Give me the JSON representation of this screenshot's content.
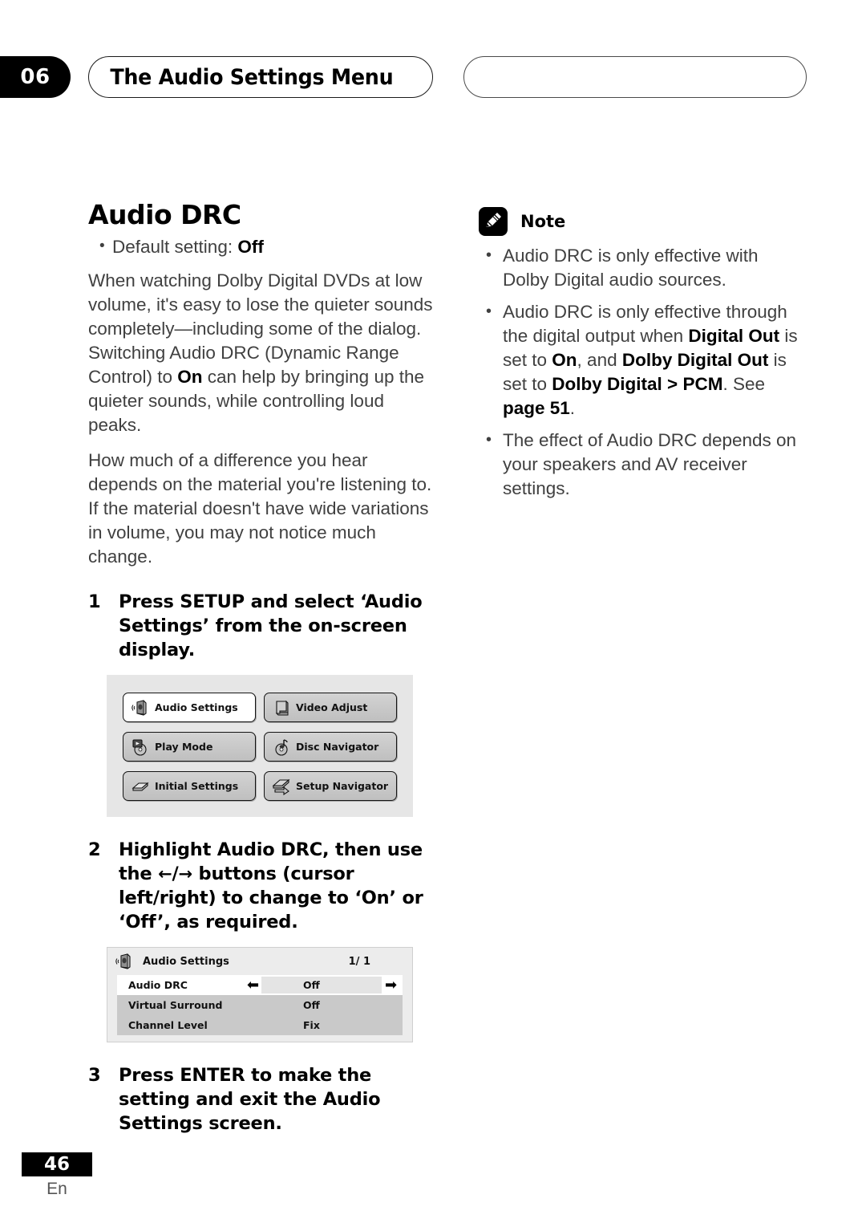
{
  "header": {
    "chapter_number": "06",
    "chapter_title": "The Audio Settings Menu"
  },
  "left_column": {
    "section_title": "Audio DRC",
    "default_setting_prefix": "Default setting: ",
    "default_setting_value": "Off",
    "paragraph_1_a": "When watching Dolby Digital DVDs at low volume, it's easy to lose the quieter sounds completely—including some of the dialog. Switching Audio DRC (Dynamic Range Control) to ",
    "paragraph_1_b": "On",
    "paragraph_1_c": " can help by bringing up the quieter sounds, while controlling loud peaks.",
    "paragraph_2": "How much of a difference you hear depends on the material you're listening to. If the material doesn't have wide variations in volume, you may not notice much change.",
    "steps": [
      {
        "num": "1",
        "text": "Press SETUP and select ‘Audio Settings’ from the on-screen display."
      },
      {
        "num": "2",
        "text_before_arrows": "Highlight Audio DRC, then use the ",
        "arrow_left": "←",
        "arrow_sep": "/",
        "arrow_right": "→",
        "text_after_arrows": " buttons (cursor left/right) to change to ‘On’ or ‘Off’, as required."
      },
      {
        "num": "3",
        "text": "Press ENTER to make the setting and exit the Audio Settings screen."
      }
    ]
  },
  "osd_menu": {
    "items": [
      {
        "label": "Audio Settings",
        "icon": "speaker-icon",
        "selected": true
      },
      {
        "label": "Video Adjust",
        "icon": "monitor-icon",
        "selected": false
      },
      {
        "label": "Play Mode",
        "icon": "play-disc-icon",
        "selected": false
      },
      {
        "label": "Disc Navigator",
        "icon": "disc-note-icon",
        "selected": false
      },
      {
        "label": "Initial Settings",
        "icon": "disc-slab-icon",
        "selected": false
      },
      {
        "label": "Setup Navigator",
        "icon": "setup-arrow-icon",
        "selected": false
      }
    ]
  },
  "osd_settings": {
    "title": "Audio Settings",
    "pager": "1/ 1",
    "rows": [
      {
        "name": "Audio DRC",
        "value": "Off",
        "active": true,
        "arrow_left": "⬅",
        "arrow_right": "➡"
      },
      {
        "name": "Virtual Surround",
        "value": "Off",
        "active": false
      },
      {
        "name": "Channel Level",
        "value": "Fix",
        "active": false
      }
    ]
  },
  "note": {
    "label": "Note",
    "bullets": [
      {
        "parts": [
          {
            "t": "Audio DRC is only effective with Dolby Digital audio sources.",
            "b": false
          }
        ]
      },
      {
        "parts": [
          {
            "t": "Audio DRC is only effective through the digital output when ",
            "b": false
          },
          {
            "t": "Digital Out",
            "b": true
          },
          {
            "t": " is set to ",
            "b": false
          },
          {
            "t": "On",
            "b": true
          },
          {
            "t": ", and ",
            "b": false
          },
          {
            "t": "Dolby Digital Out",
            "b": true
          },
          {
            "t": " is set to ",
            "b": false
          },
          {
            "t": "Dolby Digital > PCM",
            "b": true
          },
          {
            "t": ". See ",
            "b": false
          },
          {
            "t": "page 51",
            "b": true
          },
          {
            "t": ".",
            "b": false
          }
        ]
      },
      {
        "parts": [
          {
            "t": "The effect of Audio DRC depends on your speakers and AV receiver settings.",
            "b": false
          }
        ]
      }
    ]
  },
  "footer": {
    "page_number": "46",
    "language": "En"
  },
  "colors": {
    "ink": "#231f20",
    "body_gray": "#404040",
    "osd_panel_bg": "#e6e6e6",
    "osd_button_bg": "#c9c9c9",
    "osd_row_bg": "#c9c9c9"
  }
}
